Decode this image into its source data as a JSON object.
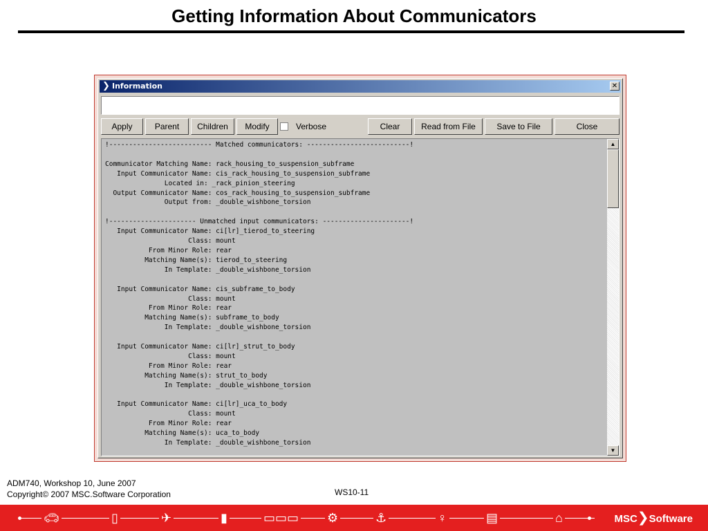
{
  "slide": {
    "title": "Getting Information About Communicators",
    "footer_line1": "ADM740, Workshop 10, June 2007",
    "footer_line2": "Copyright© 2007 MSC.Software Corporation",
    "page_code": "WS10-11",
    "brand_left": "MSC",
    "brand_right": "Software"
  },
  "window": {
    "title": "Information",
    "close_glyph": "✕",
    "command_value": ""
  },
  "toolbar": {
    "apply": "Apply",
    "parent": "Parent",
    "children": "Children",
    "modify": "Modify",
    "verbose": "Verbose",
    "verbose_checked": false,
    "clear": "Clear",
    "read_from_file": "Read from File",
    "save_to_file": "Save to File",
    "close": "Close"
  },
  "output": {
    "lines": [
      "!-------------------------- Matched communicators: --------------------------!",
      "",
      "Communicator Matching Name: rack_housing_to_suspension_subframe",
      "   Input Communicator Name: cis_rack_housing_to_suspension_subframe",
      "               Located in: _rack_pinion_steering",
      "  Output Communicator Name: cos_rack_housing_to_suspension_subframe",
      "               Output from: _double_wishbone_torsion",
      "",
      "!---------------------- Unmatched input communicators: ----------------------!",
      "   Input Communicator Name: ci[lr]_tierod_to_steering",
      "                     Class: mount",
      "           From Minor Role: rear",
      "          Matching Name(s): tierod_to_steering",
      "               In Template: _double_wishbone_torsion",
      "",
      "   Input Communicator Name: cis_subframe_to_body",
      "                     Class: mount",
      "           From Minor Role: rear",
      "          Matching Name(s): subframe_to_body",
      "               In Template: _double_wishbone_torsion",
      "",
      "   Input Communicator Name: ci[lr]_strut_to_body",
      "                     Class: mount",
      "           From Minor Role: rear",
      "          Matching Name(s): strut_to_body",
      "               In Template: _double_wishbone_torsion",
      "",
      "   Input Communicator Name: ci[lr]_uca_to_body",
      "                     Class: mount",
      "           From Minor Role: rear",
      "          Matching Name(s): uca_to_body",
      "               In Template: _double_wishbone_torsion"
    ]
  },
  "icons": {
    "app": "chevron-x-icon",
    "scroll_up": "arrow-up-icon",
    "scroll_down": "arrow-down-icon",
    "band": [
      "car-icon",
      "phone-icon",
      "airplane-icon",
      "bottle-icon",
      "train-icon",
      "gear-icon",
      "ship-icon",
      "person-icon",
      "truck-icon",
      "building-icon"
    ]
  },
  "colors": {
    "band": "#e41f1f",
    "titlebar_start": "#0a246a",
    "titlebar_end": "#a6caf0",
    "frame_border": "#c0382e",
    "window_bg": "#d4d0c8",
    "output_bg": "#c0c0c0"
  }
}
